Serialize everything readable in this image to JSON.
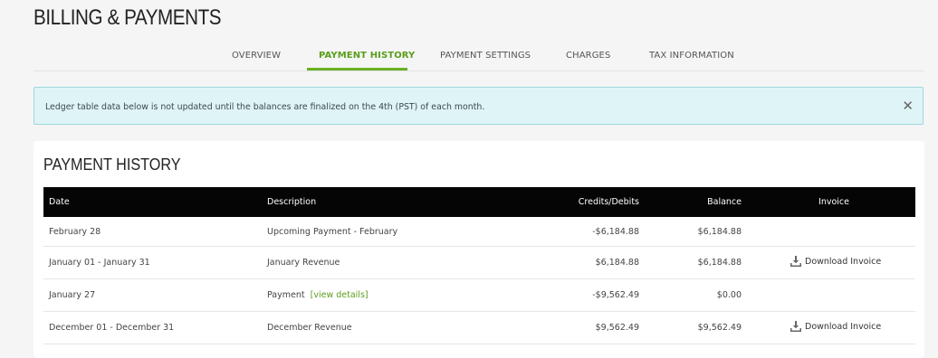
{
  "page": {
    "title": "BILLING & PAYMENTS"
  },
  "tabs": [
    {
      "label": "OVERVIEW",
      "active": false
    },
    {
      "label": "PAYMENT HISTORY",
      "active": true
    },
    {
      "label": "PAYMENT SETTINGS",
      "active": false
    },
    {
      "label": "CHARGES",
      "active": false
    },
    {
      "label": "TAX INFORMATION",
      "active": false
    }
  ],
  "alert": {
    "text": "Ledger table data below is not updated until the balances are finalized on the 4th (PST) of each month.",
    "close_icon": "close-icon"
  },
  "history": {
    "title": "PAYMENT HISTORY",
    "columns": {
      "date": "Date",
      "description": "Description",
      "credits": "Credits/Debits",
      "balance": "Balance",
      "invoice": "Invoice"
    },
    "rows": [
      {
        "date": "February 28",
        "description": "Upcoming Payment - February",
        "credits": "-$6,184.88",
        "balance": "$6,184.88",
        "invoice": ""
      },
      {
        "date": "January 01 - January 31",
        "description": "January Revenue",
        "credits": "$6,184.88",
        "balance": "$6,184.88",
        "invoice": "Download Invoice"
      },
      {
        "date": "January 27",
        "description": "Payment",
        "link": "[view details]",
        "credits": "-$9,562.49",
        "balance": "$0.00",
        "invoice": ""
      },
      {
        "date": "December 01 - December 31",
        "description": "December Revenue",
        "credits": "$9,562.49",
        "balance": "$9,562.49",
        "invoice": "Download Invoice"
      }
    ],
    "download_icon": "download-icon"
  },
  "colors": {
    "accent": "#6ab023",
    "header_bg": "#050505",
    "alert_bg": "#dff4f6"
  }
}
